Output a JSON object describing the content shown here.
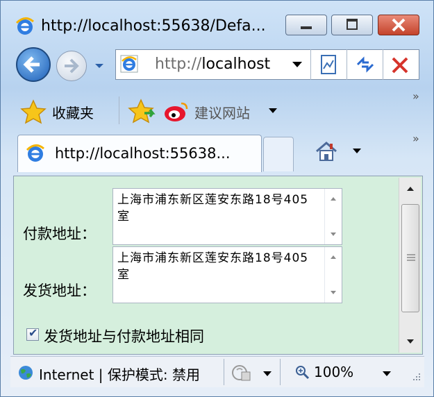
{
  "window": {
    "title": "http://localhost:55638/Defa..."
  },
  "nav": {
    "address_prefix": "http://",
    "address_host": "localhost"
  },
  "favorites": {
    "favorites_label": "收藏夹",
    "suggested_sites_label": "建议网站"
  },
  "tab": {
    "title": "http://localhost:55638..."
  },
  "form": {
    "payment_address_label": "付款地址：",
    "payment_address_value": "上海市浦东新区莲安东路18号405室",
    "shipping_address_label": "发货地址：",
    "shipping_address_value": "上海市浦东新区莲安东路18号405室",
    "same_address_checkbox_label": "发货地址与付款地址相同",
    "same_address_checked": true
  },
  "statusbar": {
    "zone_text": "Internet | 保护模式: 禁用",
    "zoom": "100%"
  }
}
